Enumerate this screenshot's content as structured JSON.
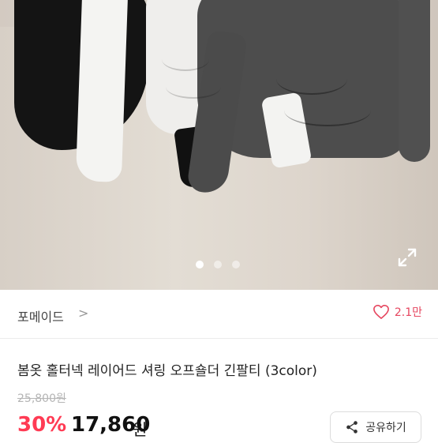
{
  "product_image": {
    "dots": [
      true,
      false,
      false
    ],
    "expand_icon": "expand-icon"
  },
  "brand": {
    "name": "포메이드",
    "chevron": ">",
    "like_count": "2.1만",
    "like_icon": "heart-icon",
    "accent": "#e6465f"
  },
  "product": {
    "title": "봄옷 홀터넥 레이어드 셔링 오프숄더 긴팔티 (3color)",
    "original_price": "25,800원",
    "discount": "30%",
    "price": "17,860",
    "currency": "원",
    "discount_color": "#ff3b54"
  },
  "share": {
    "label": "공유하기",
    "icon": "share-icon"
  }
}
